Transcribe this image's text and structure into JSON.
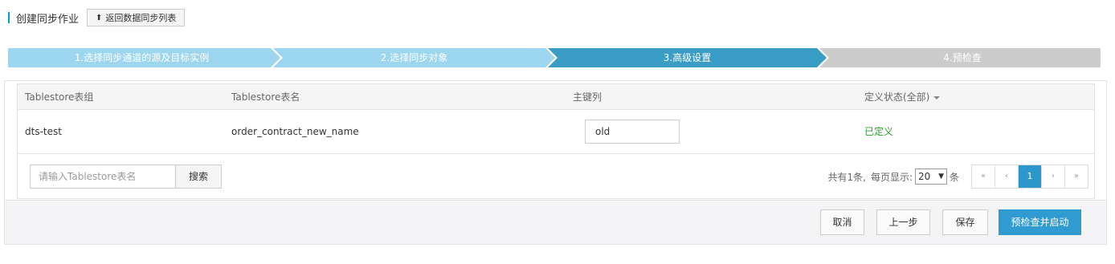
{
  "header": {
    "title": "创建同步作业",
    "back_label": "返回数据同步列表"
  },
  "steps": [
    {
      "label": "1.选择同步通道的源及目标实例",
      "color": "#9bd6ee"
    },
    {
      "label": "2.选择同步对象",
      "color": "#9bd6ee"
    },
    {
      "label": "3.高级设置",
      "color": "#3a9dc5"
    },
    {
      "label": "4.预检查",
      "color": "#cccccc"
    }
  ],
  "table": {
    "columns": [
      "Tablestore表组",
      "Tablestore表名",
      "主键列",
      "定义状态(全部)"
    ],
    "rows": [
      {
        "group": "dts-test",
        "name": "order_contract_new_name",
        "pk": "old",
        "status": "已定义"
      }
    ],
    "status_color": "#2a9c2a"
  },
  "search": {
    "placeholder": "请输入Tablestore表名",
    "button": "搜索"
  },
  "pagination": {
    "total_text": "共有1条,",
    "per_page_label": "每页显示:",
    "per_page_value": "20",
    "per_page_unit": "条",
    "first": "«",
    "prev": "‹",
    "current": "1",
    "next": "›",
    "last": "»"
  },
  "footer": {
    "cancel": "取消",
    "prev_step": "上一步",
    "save": "保存",
    "submit": "预检查并启动"
  },
  "colors": {
    "accent": "#2f9bd0",
    "active_page": "#2b97cb"
  }
}
